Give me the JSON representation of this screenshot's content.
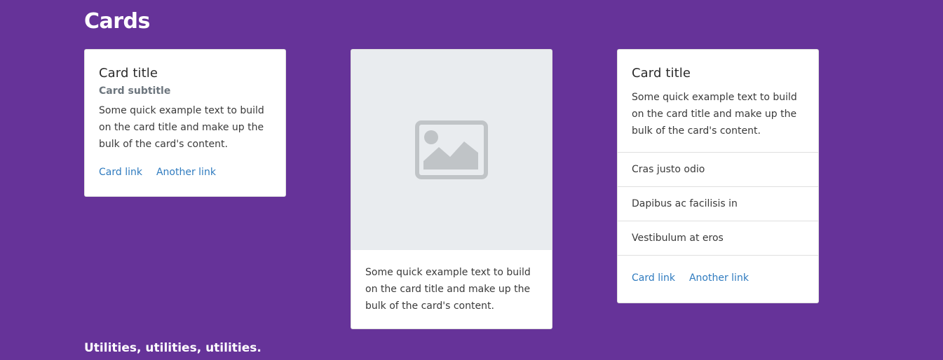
{
  "page": {
    "heading": "Cards",
    "section_heading": "Utilities, utilities, utilities."
  },
  "colors": {
    "background": "#663399",
    "link": "#2f7bbf",
    "placeholder_bg": "#e9ecef",
    "placeholder_icon": "#c0c4c7"
  },
  "card1": {
    "title": "Card title",
    "subtitle": "Card subtitle",
    "text": "Some quick example text to build on the card title and make up the bulk of the card's content.",
    "link1": "Card link",
    "link2": "Another link"
  },
  "card2": {
    "image_icon": "image-placeholder-icon",
    "text": "Some quick example text to build on the card title and make up the bulk of the card's content."
  },
  "card3": {
    "title": "Card title",
    "text": "Some quick example text to build on the card title and make up the bulk of the card's content.",
    "list": [
      "Cras justo odio",
      "Dapibus ac facilisis in",
      "Vestibulum at eros"
    ],
    "link1": "Card link",
    "link2": "Another link"
  }
}
